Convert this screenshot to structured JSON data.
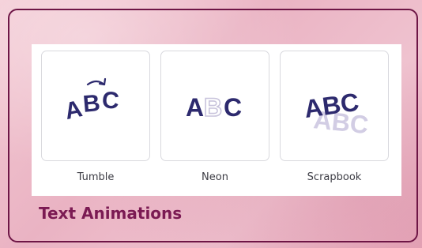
{
  "section_title": "Text Animations",
  "animations": [
    {
      "label": "Tumble",
      "preview_text": "ABC",
      "icon": "rotate-arrow-icon"
    },
    {
      "label": "Neon",
      "preview_text": "ABC"
    },
    {
      "label": "Scrapbook",
      "preview_text": "ABC"
    }
  ],
  "colors": {
    "frame_border": "#6e1646",
    "title": "#7b1a53",
    "preview_text": "#2d2a6e",
    "preview_faded": "#c9c4dc"
  }
}
